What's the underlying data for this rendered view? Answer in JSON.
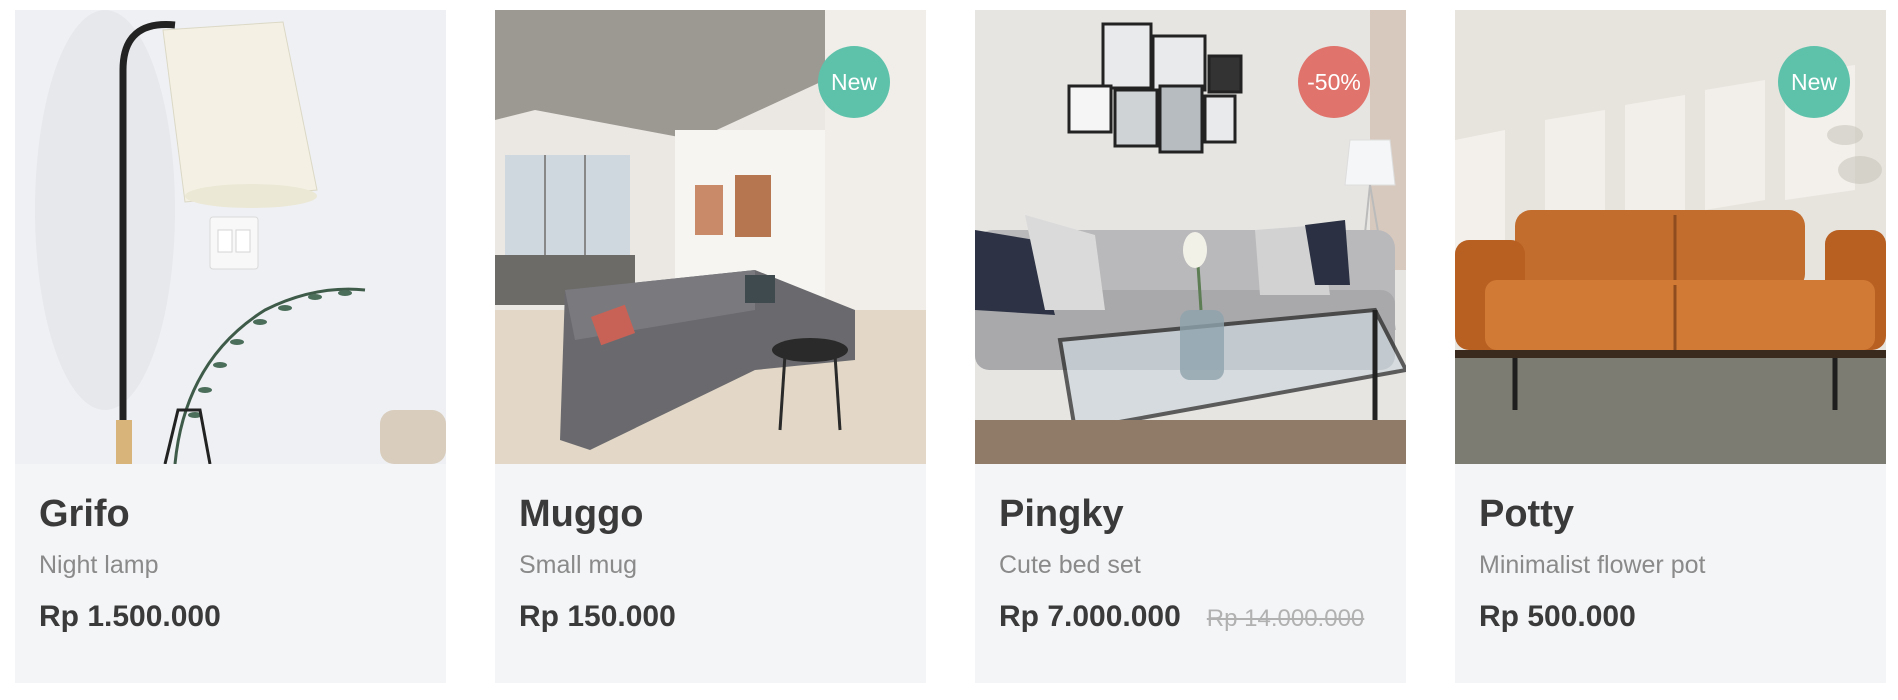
{
  "products": [
    {
      "name": "Grifo",
      "subtitle": "Night lamp",
      "price": "Rp 1.500.000",
      "badge": "",
      "old_price": ""
    },
    {
      "name": "Muggo",
      "subtitle": "Small mug",
      "price": "Rp 150.000",
      "badge": "New",
      "old_price": ""
    },
    {
      "name": "Pingky",
      "subtitle": "Cute bed set",
      "price": "Rp 7.000.000",
      "badge": "-50%",
      "old_price": "Rp 14.000.000"
    },
    {
      "name": "Potty",
      "subtitle": "Minimalist flower pot",
      "price": "Rp 500.000",
      "badge": "New",
      "old_price": ""
    }
  ],
  "colors": {
    "badge_new": "#5ec2ab",
    "badge_sale": "#e0736b",
    "card_bg": "#f4f5f7",
    "text_dark": "#3a3a3a",
    "text_muted": "#8a8a8a"
  }
}
